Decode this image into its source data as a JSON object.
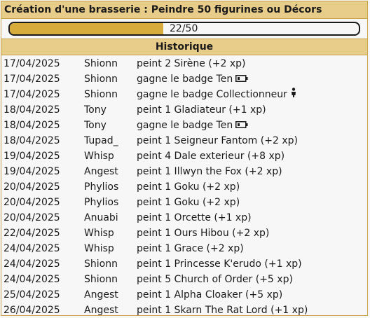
{
  "panel": {
    "title": "Création d'une brasserie : Peindre 50 figurines ou Décors",
    "progress": {
      "text": "22/50",
      "current": 22,
      "total": 50
    },
    "section_title": "Historique"
  },
  "history": [
    {
      "date": "17/04/2025",
      "user": "Shionn",
      "action": "peint 2 Sirène (+2 xp)"
    },
    {
      "date": "17/04/2025",
      "user": "Shionn",
      "action": "gagne le badge Ten",
      "icon": "battery-icon"
    },
    {
      "date": "17/04/2025",
      "user": "Shionn",
      "action": "gagne le badge Collectionneur",
      "icon": "figurine-icon"
    },
    {
      "date": "18/04/2025",
      "user": "Tony",
      "action": "peint 1 Gladiateur (+1 xp)"
    },
    {
      "date": "18/04/2025",
      "user": "Tony",
      "action": "gagne le badge Ten",
      "icon": "battery-icon"
    },
    {
      "date": "18/04/2025",
      "user": "Tupad_",
      "action": "peint 1 Seigneur Fantom (+2 xp)"
    },
    {
      "date": "19/04/2025",
      "user": "Whisp",
      "action": "peint 4 Dale exterieur (+8 xp)"
    },
    {
      "date": "19/04/2025",
      "user": "Angest",
      "action": "peint 1 Illwyn the Fox (+2 xp)"
    },
    {
      "date": "20/04/2025",
      "user": "Phylios",
      "action": "peint 1 Goku (+2 xp)"
    },
    {
      "date": "20/04/2025",
      "user": "Phylios",
      "action": "peint 1 Goku (+2 xp)"
    },
    {
      "date": "20/04/2025",
      "user": "Anuabi",
      "action": "peint 1 Orcette (+1 xp)"
    },
    {
      "date": "22/04/2025",
      "user": "Whisp",
      "action": "peint 1 Ours Hibou (+2 xp)"
    },
    {
      "date": "24/04/2025",
      "user": "Whisp",
      "action": "peint 1 Grace (+2 xp)"
    },
    {
      "date": "24/04/2025",
      "user": "Shionn",
      "action": "peint 1 Princesse K'erudo (+1 xp)"
    },
    {
      "date": "24/04/2025",
      "user": "Shionn",
      "action": "peint 5 Church of Order (+5 xp)"
    },
    {
      "date": "25/04/2025",
      "user": "Angest",
      "action": "peint 1 Alpha Cloaker (+5 xp)"
    },
    {
      "date": "26/04/2025",
      "user": "Angest",
      "action": "peint 1 Skarn The Rat Lord (+1 xp)"
    }
  ],
  "colors": {
    "header_bg": "#e8cc8a",
    "border": "#c8a24a",
    "progress_fill": "#d8ac3c"
  }
}
